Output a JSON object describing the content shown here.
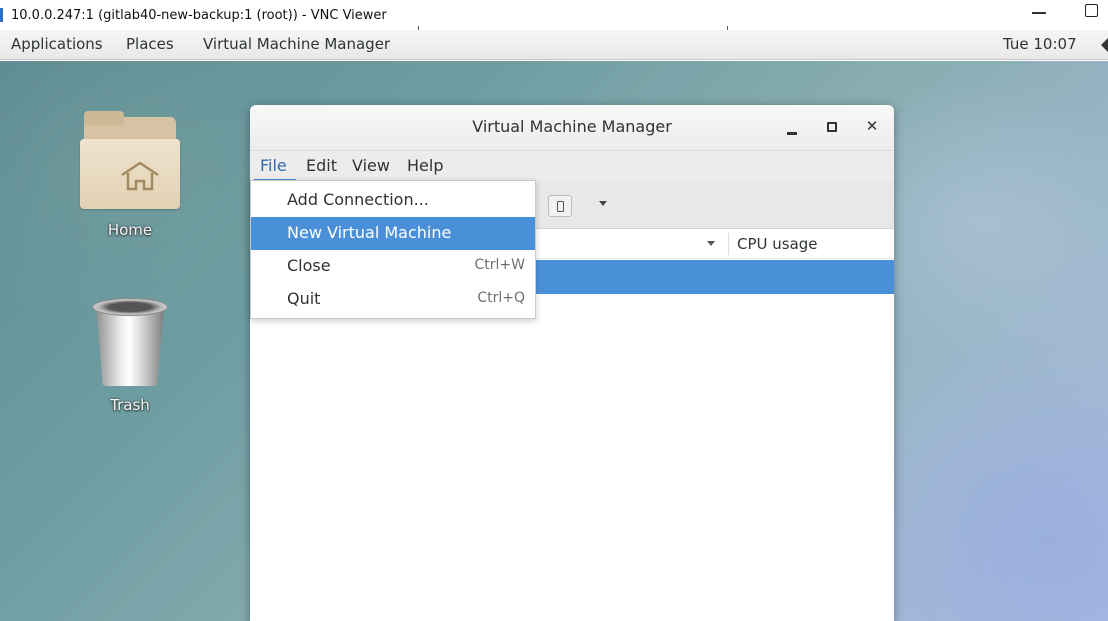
{
  "vnc": {
    "title": "10.0.0.247:1 (gitlab40-new-backup:1 (root)) - VNC Viewer"
  },
  "panel": {
    "applications": "Applications",
    "places": "Places",
    "app_menu": "Virtual Machine Manager",
    "clock": "Tue 10:07"
  },
  "desktop": {
    "icons": [
      {
        "label": "Home",
        "icon": "home-folder-icon"
      },
      {
        "label": "Trash",
        "icon": "trash-icon"
      }
    ]
  },
  "window": {
    "title": "Virtual Machine Manager",
    "menubar": [
      "File",
      "Edit",
      "View",
      "Help"
    ],
    "columns": {
      "cpu": "CPU usage"
    }
  },
  "file_menu": {
    "items": [
      {
        "label": "Add Connection...",
        "accel": ""
      },
      {
        "label": "New Virtual Machine",
        "accel": "",
        "highlighted": true
      },
      {
        "label": "Close",
        "accel": "Ctrl+W"
      },
      {
        "label": "Quit",
        "accel": "Ctrl+Q"
      }
    ]
  },
  "colors": {
    "selection": "#4a90d9",
    "panel_bg": "#ececec"
  }
}
